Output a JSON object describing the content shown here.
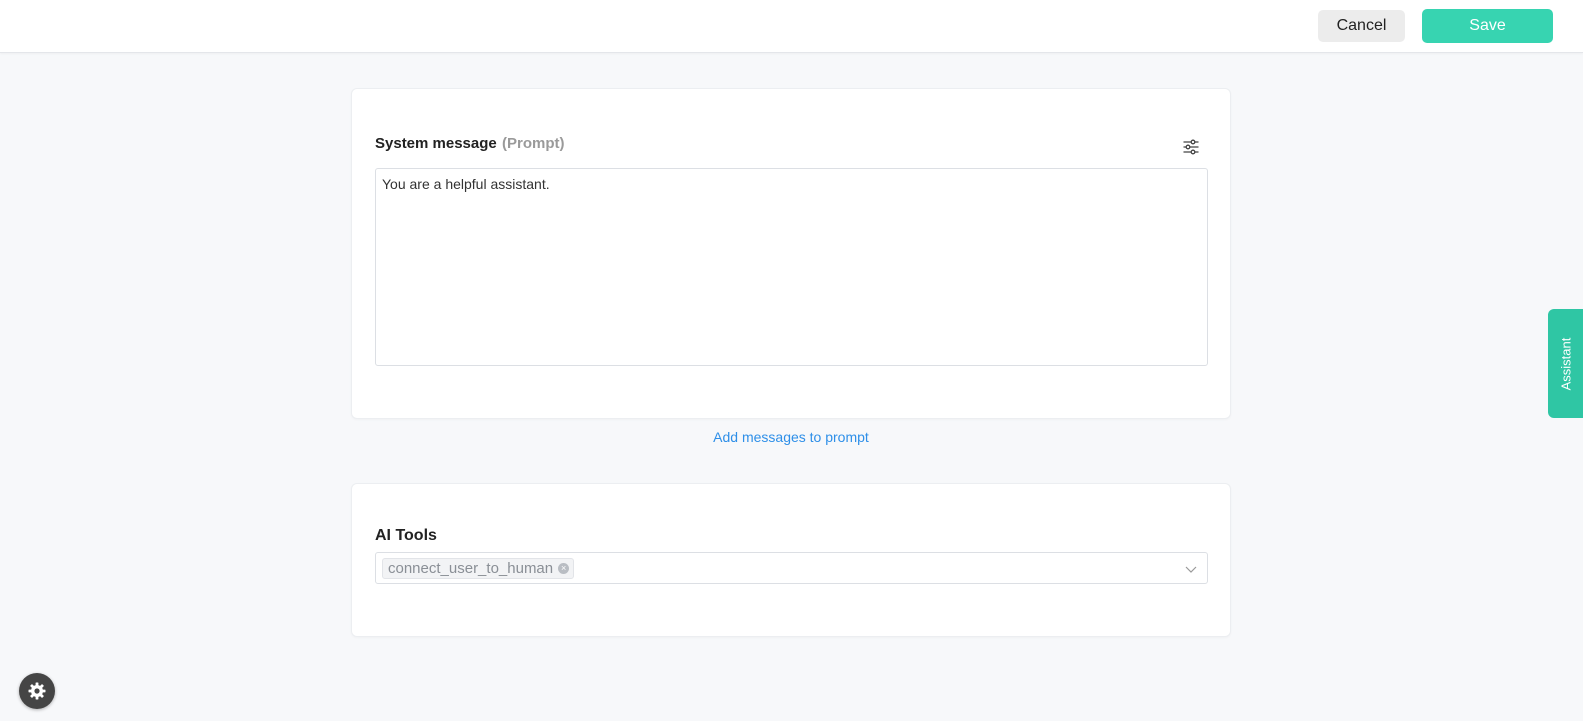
{
  "header": {
    "cancel_label": "Cancel",
    "save_label": "Save"
  },
  "prompt_card": {
    "label": "System message",
    "hint": "(Prompt)",
    "value": "You are a helpful assistant.",
    "settings_icon": "sliders-icon"
  },
  "add_messages_link": "Add messages to prompt",
  "tools_card": {
    "label": "AI Tools",
    "selected_tags": [
      "connect_user_to_human"
    ],
    "dropdown_icon": "chevron-down-icon"
  },
  "side_tab": {
    "label": "Assistant"
  },
  "floating_button": {
    "icon": "gear-icon"
  },
  "colors": {
    "accent": "#37d4b1",
    "assistant_tab": "#2fc6a4",
    "link": "#2e8fe8",
    "background": "#f7f8fa"
  }
}
